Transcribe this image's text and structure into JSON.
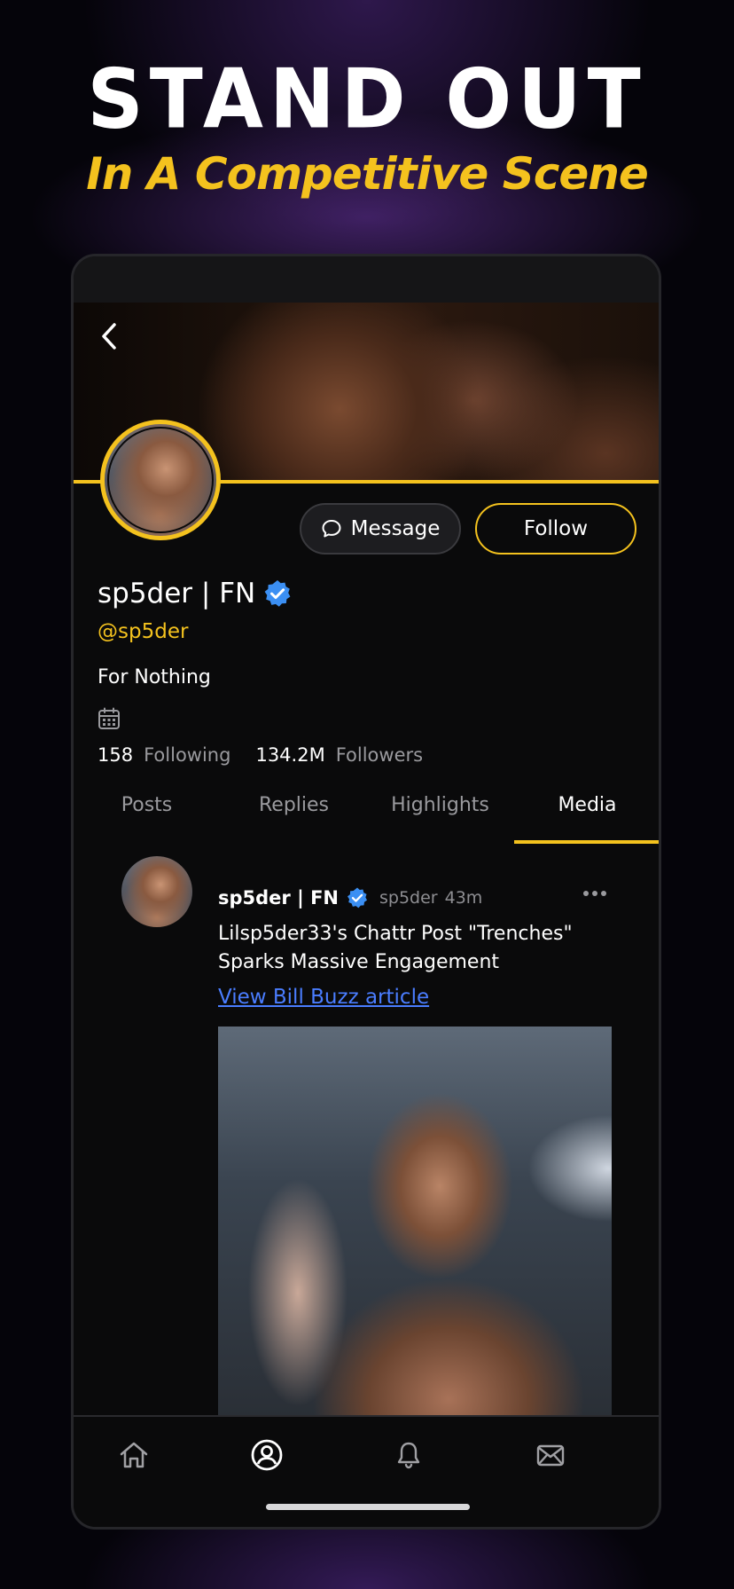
{
  "promo": {
    "headline": "STAND OUT",
    "subheadline": "In A Competitive Scene"
  },
  "profile": {
    "display_name": "sp5der | FN",
    "verified": true,
    "handle": "@sp5der",
    "bio": "For Nothing",
    "message_label": "Message",
    "follow_label": "Follow",
    "following_count": "158",
    "following_label": "Following",
    "followers_count": "134.2M",
    "followers_label": "Followers"
  },
  "tabs": [
    {
      "label": "Posts",
      "active": false
    },
    {
      "label": "Replies",
      "active": false
    },
    {
      "label": "Highlights",
      "active": false
    },
    {
      "label": "Media",
      "active": true
    }
  ],
  "post": {
    "author_name": "sp5der | FN",
    "author_handle": "sp5der",
    "time": "43m",
    "text": "Lilsp5der33's Chattr Post \"Trenches\" Sparks Massive Engagement",
    "link_text": "View Bill Buzz article"
  },
  "nav": {
    "items": [
      "home-icon",
      "profile-icon",
      "bell-icon",
      "mail-icon"
    ],
    "active": "profile-icon"
  },
  "colors": {
    "accent": "#f4c21e",
    "verified": "#3b8ff3",
    "link": "#4a7dff",
    "background": "#0a0a0b"
  }
}
